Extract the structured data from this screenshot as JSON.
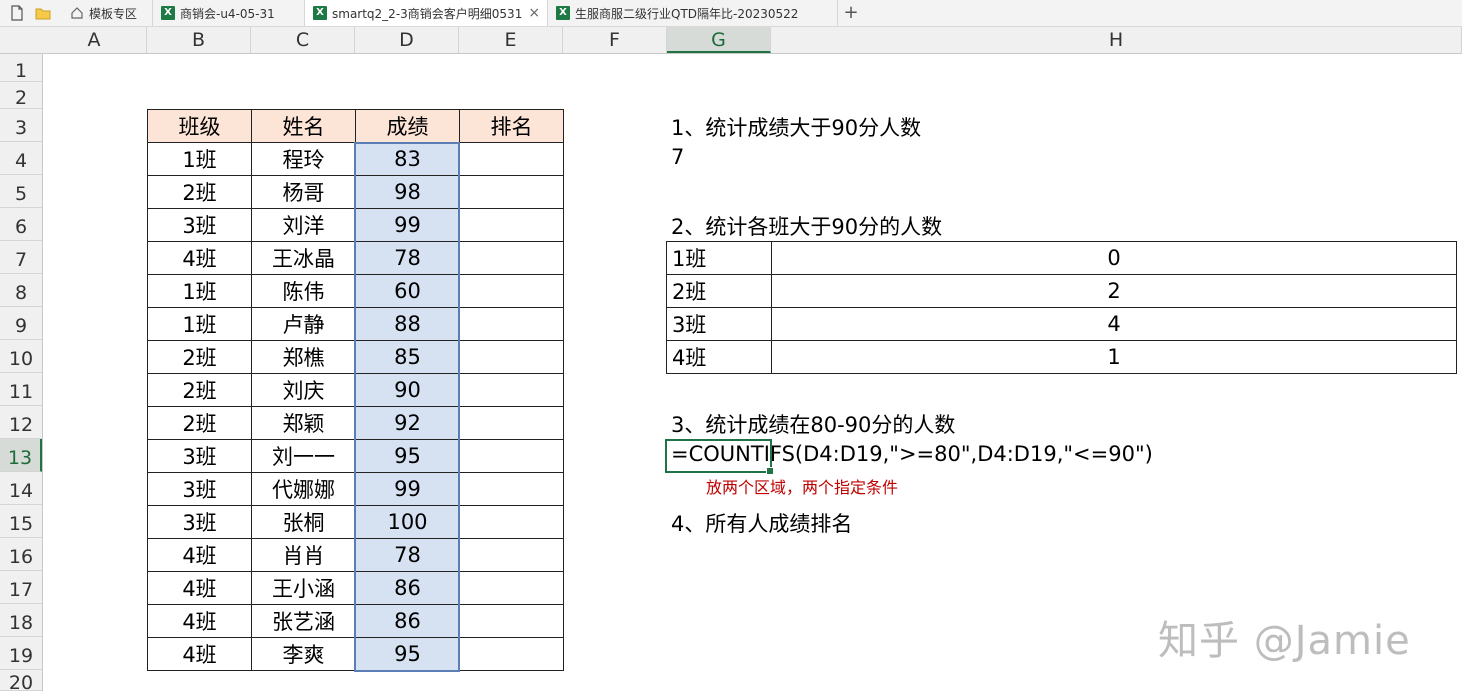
{
  "tabs": [
    {
      "label": "模板专区",
      "icon": "home-icon"
    },
    {
      "label": "商销会-u4-05-31",
      "icon": "excel-file-icon"
    },
    {
      "label": "smartq2_2-3商销会客户明细0531",
      "icon": "excel-file-icon",
      "active": true
    },
    {
      "label": "生服商服二级行业QTD隔年比-20230522",
      "icon": "excel-file-icon"
    }
  ],
  "new_tab": "+",
  "close_glyph": "×",
  "excel_glyph": "X",
  "columns": [
    "A",
    "B",
    "C",
    "D",
    "E",
    "F",
    "G",
    "H"
  ],
  "selected_column": "G",
  "rows": [
    "1",
    "2",
    "3",
    "4",
    "5",
    "6",
    "7",
    "8",
    "9",
    "10",
    "11",
    "12",
    "13",
    "14",
    "15",
    "16",
    "17",
    "18",
    "19",
    "20"
  ],
  "selected_row": "13",
  "main_table": {
    "headers": [
      "班级",
      "姓名",
      "成绩",
      "排名"
    ],
    "rows": [
      [
        "1班",
        "程玲",
        "83",
        ""
      ],
      [
        "2班",
        "杨哥",
        "98",
        ""
      ],
      [
        "3班",
        "刘洋",
        "99",
        ""
      ],
      [
        "4班",
        "王冰晶",
        "78",
        ""
      ],
      [
        "1班",
        "陈伟",
        "60",
        ""
      ],
      [
        "1班",
        "卢静",
        "88",
        ""
      ],
      [
        "2班",
        "郑樵",
        "85",
        ""
      ],
      [
        "2班",
        "刘庆",
        "90",
        ""
      ],
      [
        "2班",
        "郑颖",
        "92",
        ""
      ],
      [
        "3班",
        "刘一一",
        "95",
        ""
      ],
      [
        "3班",
        "代娜娜",
        "99",
        ""
      ],
      [
        "3班",
        "张桐",
        "100",
        ""
      ],
      [
        "4班",
        "肖肖",
        "78",
        ""
      ],
      [
        "4班",
        "王小涵",
        "86",
        ""
      ],
      [
        "4班",
        "张艺涵",
        "86",
        ""
      ],
      [
        "4班",
        "李爽",
        "95",
        ""
      ]
    ]
  },
  "q1": {
    "title": "1、统计成绩大于90分人数",
    "answer": "7"
  },
  "q2": {
    "title": "2、统计各班大于90分的人数",
    "rows": [
      [
        "1班",
        "0"
      ],
      [
        "2班",
        "2"
      ],
      [
        "3班",
        "4"
      ],
      [
        "4班",
        "1"
      ]
    ]
  },
  "q3": {
    "title": "3、统计成绩在80-90分的人数",
    "formula": "=COUNTIFS(D4:D19,\">=80\",D4:D19,\"<=90\")",
    "note": "放两个区域，两个指定条件"
  },
  "q4": {
    "title": "4、所有人成绩排名"
  },
  "watermark": "知乎 @Jamie"
}
